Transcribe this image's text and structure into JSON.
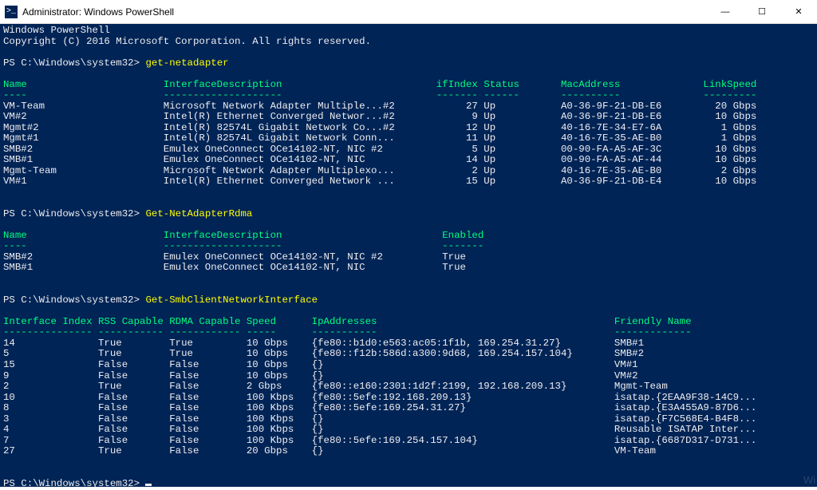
{
  "window": {
    "title": "Administrator: Windows PowerShell",
    "icon_glyph": ">_"
  },
  "header_lines": [
    "Windows PowerShell",
    "Copyright (C) 2016 Microsoft Corporation. All rights reserved."
  ],
  "prompt": "PS C:\\Windows\\system32>",
  "commands": {
    "cmd1": "get-netadapter",
    "cmd2": "Get-NetAdapterRdma",
    "cmd3": "Get-SmbClientNetworkInterface"
  },
  "table1": {
    "columns": [
      "Name",
      "InterfaceDescription",
      "ifIndex",
      "Status",
      "MacAddress",
      "LinkSpeed"
    ],
    "dashes": [
      "----",
      "--------------------",
      "-------",
      "------",
      "----------",
      "---------"
    ],
    "rows": [
      {
        "Name": "VM-Team",
        "InterfaceDescription": "Microsoft Network Adapter Multiple...#2",
        "ifIndex": "27",
        "Status": "Up",
        "MacAddress": "A0-36-9F-21-DB-E6",
        "LinkSpeed": "20 Gbps"
      },
      {
        "Name": "VM#2",
        "InterfaceDescription": "Intel(R) Ethernet Converged Networ...#2",
        "ifIndex": "9",
        "Status": "Up",
        "MacAddress": "A0-36-9F-21-DB-E6",
        "LinkSpeed": "10 Gbps"
      },
      {
        "Name": "Mgmt#2",
        "InterfaceDescription": "Intel(R) 82574L Gigabit Network Co...#2",
        "ifIndex": "12",
        "Status": "Up",
        "MacAddress": "40-16-7E-34-E7-6A",
        "LinkSpeed": "1 Gbps"
      },
      {
        "Name": "Mgmt#1",
        "InterfaceDescription": "Intel(R) 82574L Gigabit Network Conn...",
        "ifIndex": "11",
        "Status": "Up",
        "MacAddress": "40-16-7E-35-AE-B0",
        "LinkSpeed": "1 Gbps"
      },
      {
        "Name": "SMB#2",
        "InterfaceDescription": "Emulex OneConnect OCe14102-NT, NIC #2",
        "ifIndex": "5",
        "Status": "Up",
        "MacAddress": "00-90-FA-A5-AF-3C",
        "LinkSpeed": "10 Gbps"
      },
      {
        "Name": "SMB#1",
        "InterfaceDescription": "Emulex OneConnect OCe14102-NT, NIC",
        "ifIndex": "14",
        "Status": "Up",
        "MacAddress": "00-90-FA-A5-AF-44",
        "LinkSpeed": "10 Gbps"
      },
      {
        "Name": "Mgmt-Team",
        "InterfaceDescription": "Microsoft Network Adapter Multiplexo...",
        "ifIndex": "2",
        "Status": "Up",
        "MacAddress": "40-16-7E-35-AE-B0",
        "LinkSpeed": "2 Gbps"
      },
      {
        "Name": "VM#1",
        "InterfaceDescription": "Intel(R) Ethernet Converged Network ...",
        "ifIndex": "15",
        "Status": "Up",
        "MacAddress": "A0-36-9F-21-DB-E4",
        "LinkSpeed": "10 Gbps"
      }
    ]
  },
  "table2": {
    "columns": [
      "Name",
      "InterfaceDescription",
      "Enabled"
    ],
    "dashes": [
      "----",
      "--------------------",
      "-------"
    ],
    "rows": [
      {
        "Name": "SMB#2",
        "InterfaceDescription": "Emulex OneConnect OCe14102-NT, NIC #2",
        "Enabled": "True"
      },
      {
        "Name": "SMB#1",
        "InterfaceDescription": "Emulex OneConnect OCe14102-NT, NIC",
        "Enabled": "True"
      }
    ]
  },
  "table3": {
    "columns": [
      "Interface Index",
      "RSS Capable",
      "RDMA Capable",
      "Speed",
      "IpAddresses",
      "Friendly Name"
    ],
    "dashes": [
      "--------------- ",
      "-----------",
      "------------",
      "-----",
      "-----------",
      "-------------"
    ],
    "rows": [
      {
        "Index": "14",
        "RSS": "True",
        "RDMA": "True",
        "Speed": "10 Gbps",
        "Ip": "{fe80::b1d0:e563:ac05:1f1b, 169.254.31.27}",
        "FN": "SMB#1"
      },
      {
        "Index": "5",
        "RSS": "True",
        "RDMA": "True",
        "Speed": "10 Gbps",
        "Ip": "{fe80::f12b:586d:a300:9d68, 169.254.157.104}",
        "FN": "SMB#2"
      },
      {
        "Index": "15",
        "RSS": "False",
        "RDMA": "False",
        "Speed": "10 Gbps",
        "Ip": "{}",
        "FN": "VM#1"
      },
      {
        "Index": "9",
        "RSS": "False",
        "RDMA": "False",
        "Speed": "10 Gbps",
        "Ip": "{}",
        "FN": "VM#2"
      },
      {
        "Index": "2",
        "RSS": "True",
        "RDMA": "False",
        "Speed": "2 Gbps",
        "Ip": "{fe80::e160:2301:1d2f:2199, 192.168.209.13}",
        "FN": "Mgmt-Team"
      },
      {
        "Index": "10",
        "RSS": "False",
        "RDMA": "False",
        "Speed": "100 Kbps",
        "Ip": "{fe80::5efe:192.168.209.13}",
        "FN": "isatap.{2EAA9F38-14C9..."
      },
      {
        "Index": "8",
        "RSS": "False",
        "RDMA": "False",
        "Speed": "100 Kbps",
        "Ip": "{fe80::5efe:169.254.31.27}",
        "FN": "isatap.{E3A455A9-87D6..."
      },
      {
        "Index": "3",
        "RSS": "False",
        "RDMA": "False",
        "Speed": "100 Kbps",
        "Ip": "{}",
        "FN": "isatap.{F7C568E4-B4F8..."
      },
      {
        "Index": "4",
        "RSS": "False",
        "RDMA": "False",
        "Speed": "100 Kbps",
        "Ip": "{}",
        "FN": "Reusable ISATAP Inter..."
      },
      {
        "Index": "7",
        "RSS": "False",
        "RDMA": "False",
        "Speed": "100 Kbps",
        "Ip": "{fe80::5efe:169.254.157.104}",
        "FN": "isatap.{6687D317-D731..."
      },
      {
        "Index": "27",
        "RSS": "True",
        "RDMA": "False",
        "Speed": "20 Gbps",
        "Ip": "{}",
        "FN": "VM-Team"
      }
    ]
  },
  "watermark": "Wi"
}
